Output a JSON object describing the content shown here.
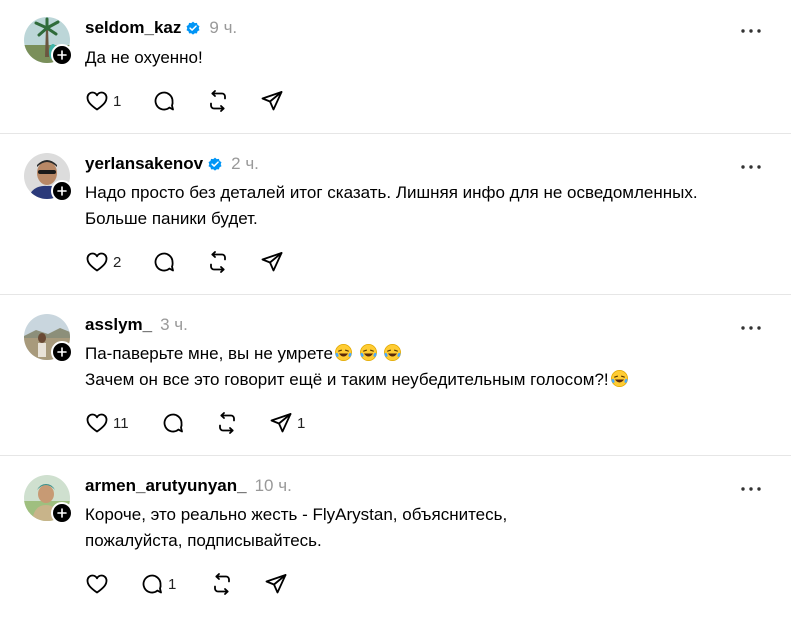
{
  "posts": [
    {
      "username": "seldom_kaz",
      "verified": true,
      "time": "9 ч.",
      "lines": [
        "Да не охуенно!"
      ],
      "likes": "1",
      "replies": "",
      "reposts": "",
      "shares": ""
    },
    {
      "username": "yerlansakenov",
      "verified": true,
      "time": "2 ч.",
      "lines": [
        "Надо просто без деталей итог сказать. Лишняя инфо для не осведомленных.",
        "Больше паники будет."
      ],
      "likes": "2",
      "replies": "",
      "reposts": "",
      "shares": ""
    },
    {
      "username": "asslym_",
      "verified": false,
      "time": "3 ч.",
      "lines": [
        "Па-паверьте мне, вы не умрете",
        "Зачем он все это говорит ещё и таким неубедительным голосом?!"
      ],
      "likes": "11",
      "replies": "",
      "reposts": "",
      "shares": "1"
    },
    {
      "username": "armen_arutyunyan_",
      "verified": false,
      "time": "10 ч.",
      "lines": [
        "Короче, это реально жесть - FlyArystan, объяснитесь,",
        "пожалуйста, подписывайтесь."
      ],
      "likes": "",
      "replies": "1",
      "reposts": "",
      "shares": ""
    }
  ],
  "icons": {
    "verified": "verified-badge-icon",
    "follow": "plus-icon",
    "more": "more-dots-icon",
    "like": "heart-icon",
    "reply": "comment-bubble-icon",
    "repost": "repost-icon",
    "share": "send-icon",
    "emoji": "rolling-on-floor-laughing-emoji"
  },
  "colors": {
    "verified": "#0095f6",
    "muted": "#999999",
    "divider": "#e6e6e6"
  }
}
